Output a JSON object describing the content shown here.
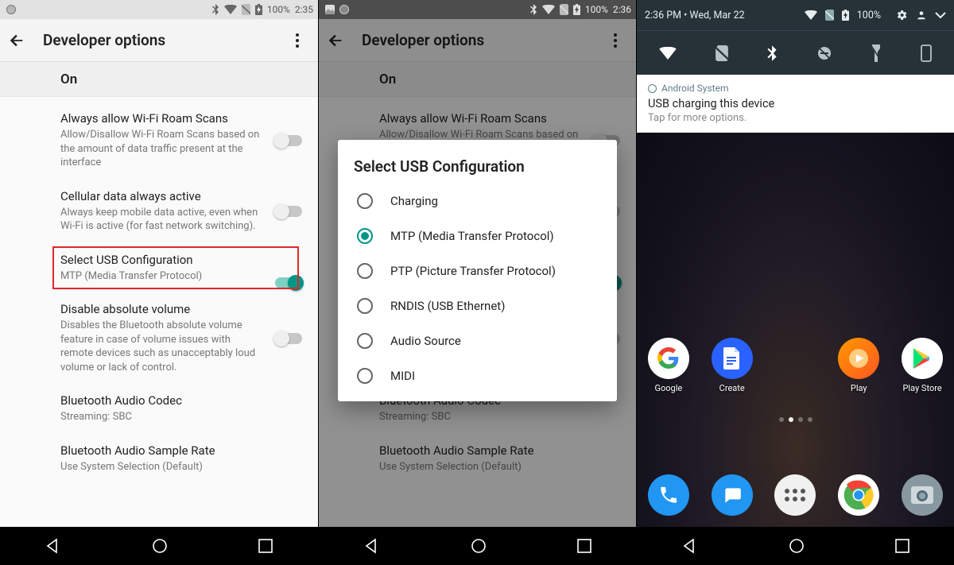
{
  "screen1": {
    "status": {
      "battery": "100%",
      "time": "2:35"
    },
    "appbar_title": "Developer options",
    "master": {
      "label": "On",
      "checked": true
    },
    "items": [
      {
        "title": "Always allow Wi-Fi Roam Scans",
        "sub": "Allow/Disallow Wi-Fi Roam Scans based on the amount of data traffic present at the interface",
        "switch": "off"
      },
      {
        "title": "Cellular data always active",
        "sub": "Always keep mobile data active, even when Wi-Fi is active (for fast network switching).",
        "switch": "off"
      },
      {
        "title": "Select USB Configuration",
        "sub": "MTP (Media Transfer Protocol)",
        "switch": null,
        "highlight": true
      },
      {
        "title": "Disable absolute volume",
        "sub": "Disables the Bluetooth absolute volume feature in case of volume issues with remote devices such as unacceptably loud volume or lack of control.",
        "switch": "off"
      },
      {
        "title": "Bluetooth Audio Codec",
        "sub": "Streaming: SBC",
        "switch": null
      },
      {
        "title": "Bluetooth Audio Sample Rate",
        "sub": "Use System Selection (Default)",
        "switch": null
      }
    ]
  },
  "screen2": {
    "status": {
      "battery": "100%",
      "time": "2:36"
    },
    "dialog_title": "Select USB Configuration",
    "options": [
      {
        "label": "Charging",
        "selected": false
      },
      {
        "label": "MTP (Media Transfer Protocol)",
        "selected": true
      },
      {
        "label": "PTP (Picture Transfer Protocol)",
        "selected": false
      },
      {
        "label": "RNDIS (USB Ethernet)",
        "selected": false
      },
      {
        "label": "Audio Source",
        "selected": false
      },
      {
        "label": "MIDI",
        "selected": false
      }
    ]
  },
  "screen3": {
    "shade": {
      "time_date": "2:36 PM  •  Wed, Mar 22",
      "battery": "100%"
    },
    "notification": {
      "app": "Android System",
      "title": "USB charging this device",
      "sub": "Tap for more options."
    },
    "row1_labels": [
      "Google",
      "Create",
      "",
      "Play",
      "Play Store"
    ],
    "row1_colors": [
      "#ffffff",
      "#2962ff",
      "",
      "#ff8a00",
      "#ffffff"
    ],
    "row2_colors": [
      "#2196f3",
      "#2196f3",
      "#ffffff",
      "#ffffff",
      "#9e9e9e"
    ]
  }
}
